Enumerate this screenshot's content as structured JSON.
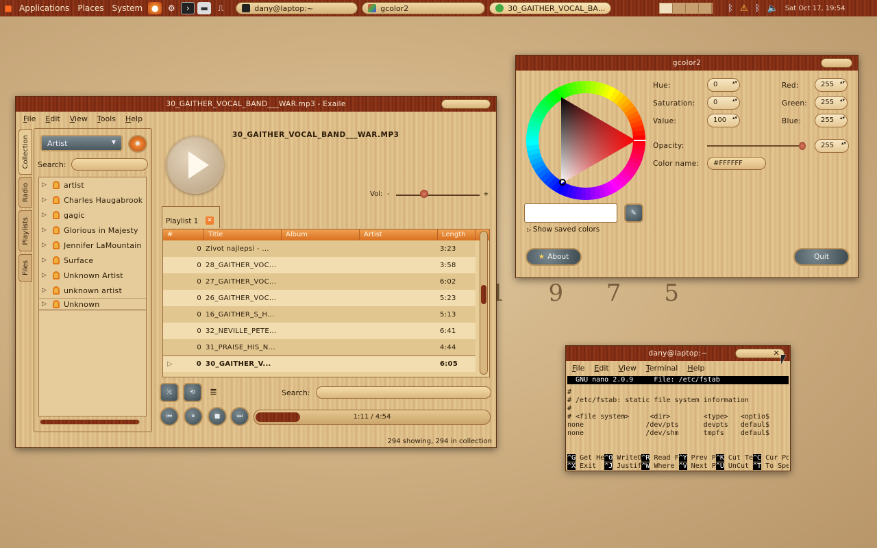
{
  "panel": {
    "applications": "Applications",
    "places": "Places",
    "system": "System",
    "tasks": [
      {
        "label": "dany@laptop:~"
      },
      {
        "label": "gcolor2"
      },
      {
        "label": "30_GAITHER_VOCAL_BA..."
      }
    ],
    "clock": "Sat Oct 17, 19:54"
  },
  "desktop": {
    "watermark": "1 9 7 5"
  },
  "exaile": {
    "title": "30_GAITHER_VOCAL_BAND___WAR.mp3 - Exaile",
    "menu": [
      "File",
      "Edit",
      "View",
      "Tools",
      "Help"
    ],
    "sidetabs": [
      "Collection",
      "Radio",
      "Playlists",
      "Files"
    ],
    "view_select": "Artist",
    "search_label": "Search:",
    "tree": [
      "artist",
      "Charles Haugabrook",
      "gagic",
      "Glorious in Majesty",
      "Jennifer LaMountain",
      "Surface",
      "Unknown Artist",
      "unknown artist",
      "Unknown"
    ],
    "now_playing": "30_GAITHER_VOCAL_BAND___WAR.MP3",
    "vol_label": "Vol:",
    "vol_minus": "-",
    "vol_plus": "+",
    "playlist_tab": "Playlist 1",
    "columns": [
      "#",
      "Title",
      "Album",
      "Artist",
      "Length"
    ],
    "rows": [
      {
        "num": "0",
        "title": "Zivot najlepsi - ...",
        "album": "",
        "artist": "",
        "length": "3:23"
      },
      {
        "num": "0",
        "title": "28_GAITHER_VOC...",
        "album": "",
        "artist": "",
        "length": "3:58"
      },
      {
        "num": "0",
        "title": "27_GAITHER_VOC...",
        "album": "",
        "artist": "",
        "length": "6:02"
      },
      {
        "num": "0",
        "title": "26_GAITHER_VOC...",
        "album": "",
        "artist": "",
        "length": "5:23"
      },
      {
        "num": "0",
        "title": "16_GAITHER_S_H...",
        "album": "",
        "artist": "",
        "length": "5:13"
      },
      {
        "num": "0",
        "title": "32_NEVILLE_PETE...",
        "album": "",
        "artist": "",
        "length": "6:41"
      },
      {
        "num": "0",
        "title": "31_PRAISE_HIS_N...",
        "album": "",
        "artist": "",
        "length": "4:44"
      },
      {
        "num": "0",
        "title": "30_GAITHER_V...",
        "album": "",
        "artist": "",
        "length": "6:05"
      }
    ],
    "search_label2": "Search:",
    "progress_text": "1:11 / 4:54",
    "progress": 0.24,
    "status": "294 showing, 294 in collection"
  },
  "gcolor": {
    "title": "gcolor2",
    "hue_label": "Hue:",
    "hue": "0",
    "sat_label": "Saturation:",
    "sat": "0",
    "val_label": "Value:",
    "val": "100",
    "red_label": "Red:",
    "red": "255",
    "green_label": "Green:",
    "green": "255",
    "blue_label": "Blue:",
    "blue": "255",
    "opacity_label": "Opacity:",
    "opacity": "255",
    "colorname_label": "Color name:",
    "colorname": "#FFFFFF",
    "saved_colors": "Show saved colors",
    "about": "About",
    "quit": "Quit",
    "selected_color": "#FFFFFF"
  },
  "terminal": {
    "title": "dany@laptop:~",
    "menu": [
      "File",
      "Edit",
      "View",
      "Terminal",
      "Help"
    ],
    "header": "  GNU nano 2.0.9     File: /etc/fstab                    ",
    "lines": [
      "#",
      "# /etc/fstab: static file system information",
      "#",
      "# <file system>     <dir>        <type>   <optio$",
      "none               /dev/pts      devpts   defaul$",
      "none               /dev/shm      tmpfs    defaul$",
      "",
      "",
      ""
    ],
    "keys1": [
      [
        "^G",
        "Get He"
      ],
      [
        "^O",
        "WriteO"
      ],
      [
        "^R",
        "Read F"
      ],
      [
        "^Y",
        "Prev P"
      ],
      [
        "^K",
        "Cut Te"
      ],
      [
        "^C",
        "Cur Po"
      ]
    ],
    "keys2": [
      [
        "^X",
        "Exit  "
      ],
      [
        "^J",
        "Justif"
      ],
      [
        "^W",
        "Where "
      ],
      [
        "^V",
        "Next P"
      ],
      [
        "^U",
        "UnCut "
      ],
      [
        "^T",
        "To Spe"
      ]
    ]
  }
}
